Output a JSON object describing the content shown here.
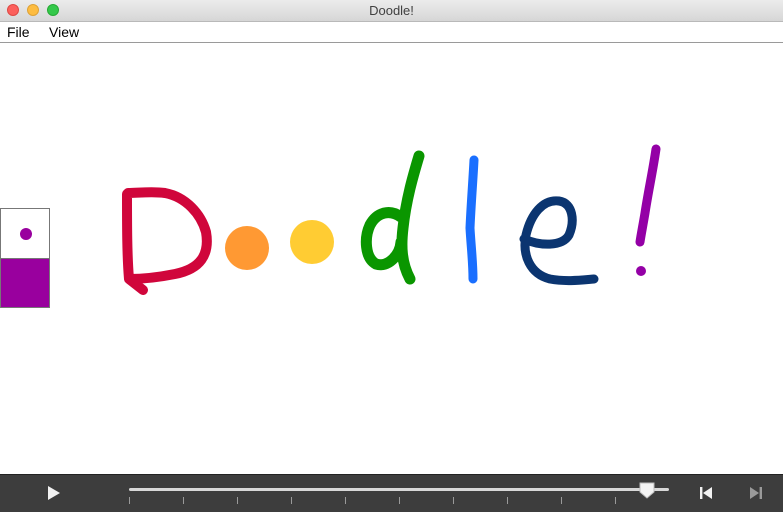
{
  "window": {
    "title": "Doodle!",
    "buttons": [
      "close",
      "minimize",
      "zoom"
    ]
  },
  "menu": {
    "items": [
      {
        "label": "File"
      },
      {
        "label": "View"
      }
    ]
  },
  "drawing": {
    "strokes": [
      {
        "letter": "D",
        "color": "#d0063b"
      },
      {
        "letter": "o",
        "color": "#ff9933",
        "shape": "filled-circle"
      },
      {
        "letter": "o",
        "color": "#ffcc33",
        "shape": "filled-circle"
      },
      {
        "letter": "d",
        "color": "#0a9600"
      },
      {
        "letter": "l",
        "color": "#1a6fff"
      },
      {
        "letter": "e",
        "color": "#0b3570"
      },
      {
        "letter": "!",
        "color": "#9400a6"
      }
    ]
  },
  "tool_panel": {
    "current_color": "#99009e",
    "brush_icon": "brush-size-dot"
  },
  "playback": {
    "play_icon": "play-icon",
    "progress": 0.96,
    "tick_count": 10,
    "previous_icon": "skip-back-icon",
    "next_icon": "skip-forward-icon"
  },
  "colors": {
    "control_bar": "#3d3d3d"
  }
}
